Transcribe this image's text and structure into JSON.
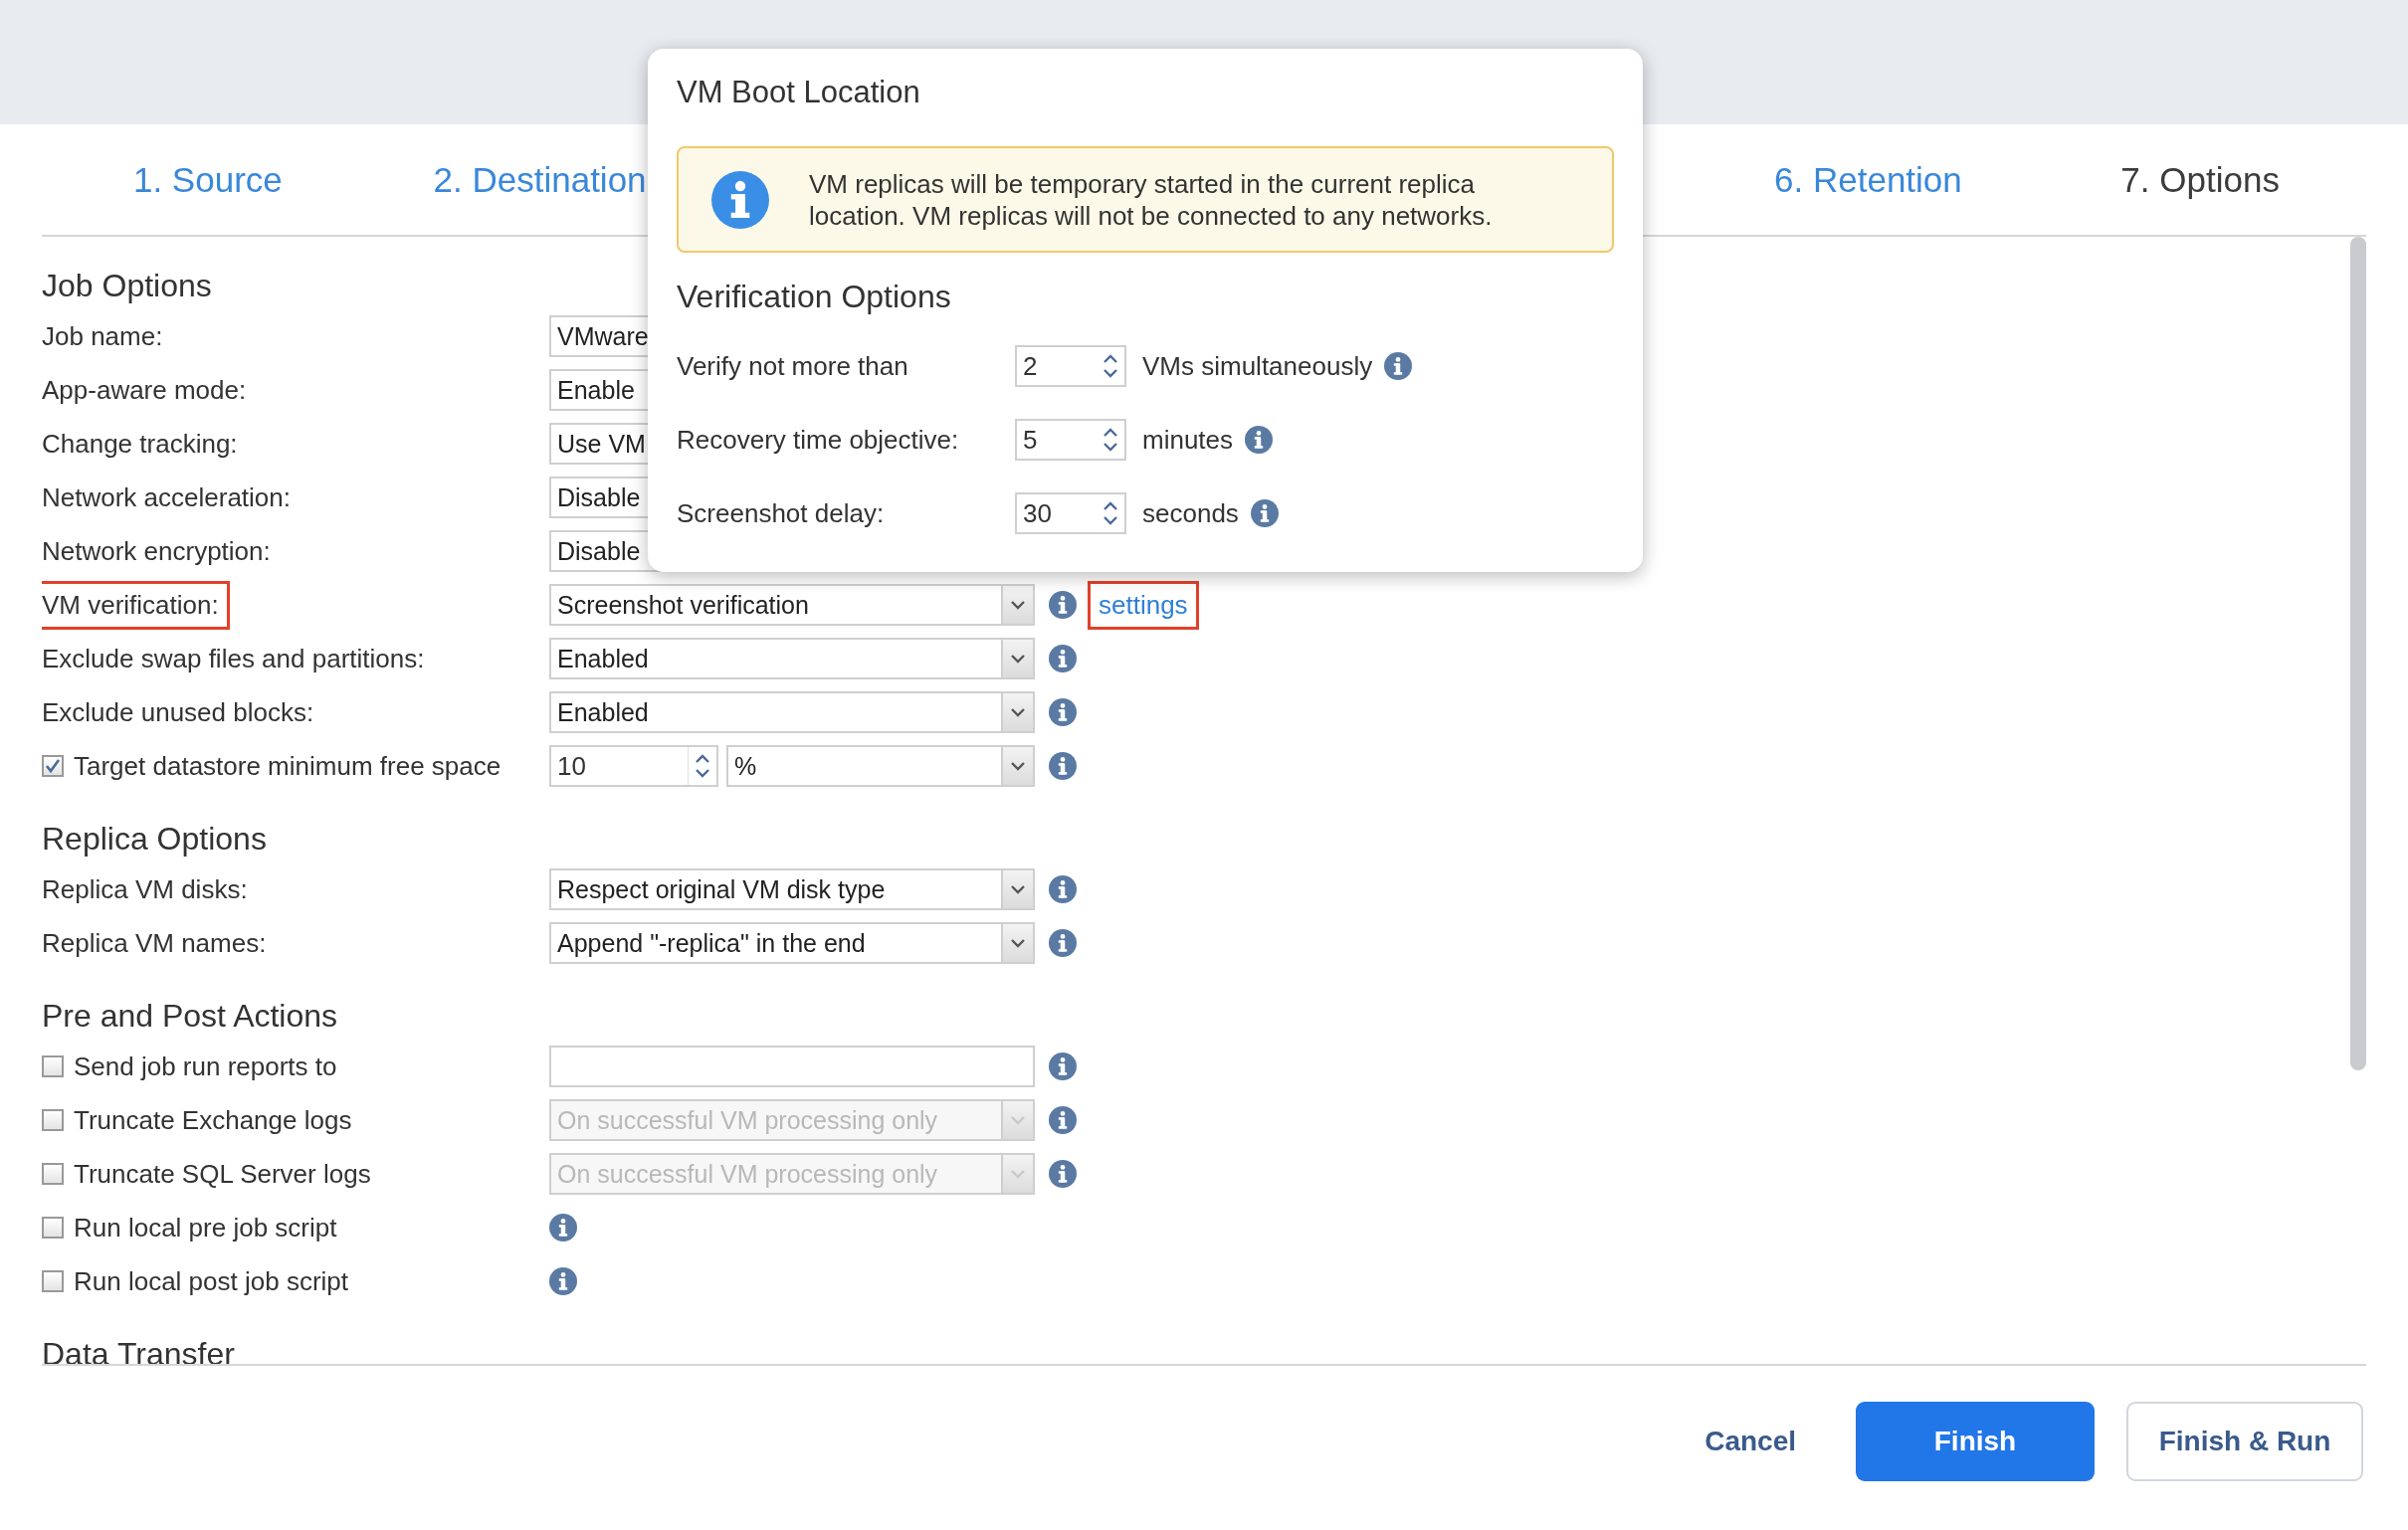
{
  "tabs": [
    {
      "label": "1. Source",
      "selected": false
    },
    {
      "label": "2. Destination",
      "selected": false
    },
    {
      "label": "6. Retention",
      "selected": false
    },
    {
      "label": "7. Options",
      "selected": true
    }
  ],
  "sections": [
    {
      "title": "Job Options",
      "rows": [
        {
          "label": "Job name:",
          "kind": "text",
          "value": "VMware"
        },
        {
          "label": "App-aware mode:",
          "kind": "select",
          "value": "Enable"
        },
        {
          "label": "Change tracking:",
          "kind": "select",
          "value": "Use VM"
        },
        {
          "label": "Network acceleration:",
          "kind": "select",
          "value": "Disable"
        },
        {
          "label": "Network encryption:",
          "kind": "select",
          "value": "Disable"
        },
        {
          "label": "VM verification:",
          "kind": "select",
          "value": "Screenshot verification",
          "info": true,
          "highlighted": true,
          "link": {
            "text": "settings",
            "highlighted": true
          }
        },
        {
          "label": "Exclude swap files and partitions:",
          "kind": "select",
          "value": "Enabled",
          "info": true
        },
        {
          "label": "Exclude unused blocks:",
          "kind": "select",
          "value": "Enabled",
          "info": true
        },
        {
          "label": "Target datastore minimum free space",
          "kind": "spin-select",
          "checked": true,
          "value": "10",
          "unit": "%",
          "info": true
        }
      ]
    },
    {
      "title": "Replica Options",
      "rows": [
        {
          "label": "Replica VM disks:",
          "kind": "select",
          "value": "Respect original VM disk type",
          "info": true
        },
        {
          "label": "Replica VM names:",
          "kind": "select",
          "value": "Append \"-replica\" in the end",
          "info": true
        }
      ]
    },
    {
      "title": "Pre and Post Actions",
      "rows": [
        {
          "label": "Send job run reports to",
          "kind": "text",
          "checked": false,
          "info": true
        },
        {
          "label": "Truncate Exchange logs",
          "kind": "select",
          "checked": false,
          "disabled": true,
          "value": "On successful VM processing only",
          "info": true
        },
        {
          "label": "Truncate SQL Server logs",
          "kind": "select",
          "checked": false,
          "disabled": true,
          "value": "On successful VM processing only",
          "info": true
        },
        {
          "label": "Run local pre job script",
          "kind": "none",
          "checked": false,
          "info": true
        },
        {
          "label": "Run local post job script",
          "kind": "none",
          "checked": false,
          "info": true
        }
      ]
    },
    {
      "title": "Data Transfer"
    }
  ],
  "popup": {
    "title": "VM Boot Location",
    "banner": "VM replicas will be temporary started in the current replica location. VM replicas will not be connected to any networks.",
    "heading": "Verification Options",
    "rows": [
      {
        "label": "Verify not more than",
        "value": "2",
        "unit": "VMs simultaneously"
      },
      {
        "label": "Recovery time objective:",
        "value": "5",
        "unit": "minutes"
      },
      {
        "label": "Screenshot delay:",
        "value": "30",
        "unit": "seconds"
      }
    ]
  },
  "buttons": [
    {
      "label": "Cancel",
      "kind": "link"
    },
    {
      "label": "Finish",
      "kind": "primary"
    },
    {
      "label": "Finish & Run",
      "kind": "secondary"
    }
  ]
}
